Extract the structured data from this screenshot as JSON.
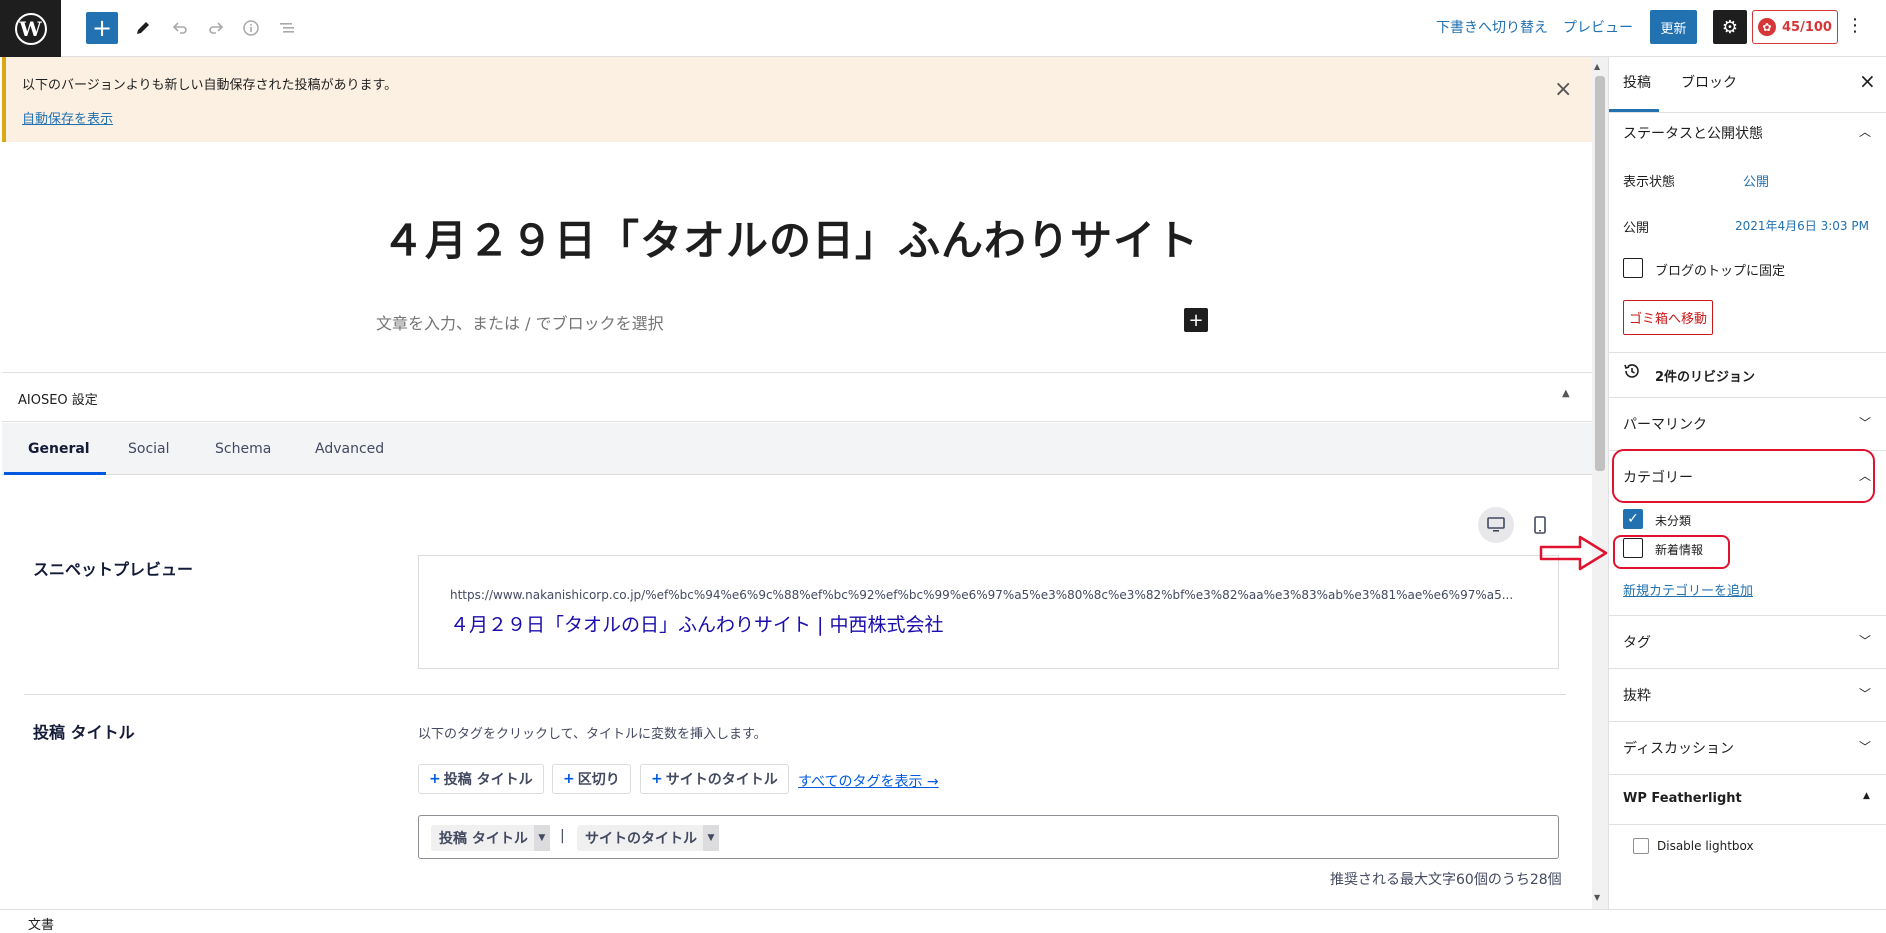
{
  "toolbar": {
    "logo_letter": "W",
    "add_icon": "+",
    "tools": [
      "pencil-icon",
      "undo-icon",
      "redo-icon",
      "info-icon",
      "list-view-icon"
    ],
    "switch_to_draft": "下書きへ切り替え",
    "preview": "プレビュー",
    "update": "更新",
    "settings_icon": "gear-icon",
    "seo_score": "45/100",
    "more_icon": "⋮"
  },
  "notice": {
    "message": "以下のバージョンよりも新しい自動保存された投稿があります。",
    "link": "自動保存を表示",
    "close": "×"
  },
  "post": {
    "title": "４月２９日「タオルの日」ふんわりサイト",
    "block_placeholder": "文章を入力、または / でブロックを選択"
  },
  "aioseo": {
    "header": "AIOSEO 設定",
    "tabs": [
      "General",
      "Social",
      "Schema",
      "Advanced"
    ],
    "active_tab": "General",
    "snippet_label": "スニペットプレビュー",
    "snippet_url": "https://www.nakanishicorp.co.jp/%ef%bc%94%e6%9c%88%ef%bc%92%ef%bc%99%e6%97%a5%e3%80%8c%e3%82%bf%e3%82%aa%e3%83%ab%e3%81%ae%e6%97%a5...",
    "snippet_title": "４月２９日「タオルの日」ふんわりサイト | 中西株式会社",
    "post_title_label": "投稿 タイトル",
    "tag_help": "以下のタグをクリックして、タイトルに変数を挿入します。",
    "tag_buttons": [
      "投稿 タイトル",
      "区切り",
      "サイトのタイトル"
    ],
    "show_all_tags": "すべてのタグを表示 →",
    "title_chips": [
      "投稿 タイトル",
      "サイトのタイトル"
    ],
    "chip_separator": "|",
    "char_count": "推奨される最大文字60個のうち28個"
  },
  "footer": {
    "breadcrumb": "文書"
  },
  "sidebar": {
    "tabs": [
      "投稿",
      "ブロック"
    ],
    "close": "×",
    "status_panel": {
      "title": "ステータスと公開状態",
      "visibility_label": "表示状態",
      "visibility_value": "公開",
      "publish_label": "公開",
      "publish_value": "2021年4月6日 3:03 PM",
      "sticky_label": "ブログのトップに固定",
      "trash_button": "ゴミ箱へ移動"
    },
    "revisions": "2件のリビジョン",
    "permalink": "パーマリンク",
    "categories": {
      "title": "カテゴリー",
      "items": [
        {
          "label": "未分類",
          "checked": true
        },
        {
          "label": "新着情報",
          "checked": false
        }
      ],
      "add_new": "新規カテゴリーを追加"
    },
    "tags": "タグ",
    "excerpt": "抜粋",
    "discussion": "ディスカッション",
    "featherlight": {
      "title": "WP Featherlight",
      "disable_label": "Disable lightbox"
    }
  },
  "colors": {
    "accent": "#2271b1",
    "annotation": "#e0122f",
    "danger": "#cc1818"
  }
}
